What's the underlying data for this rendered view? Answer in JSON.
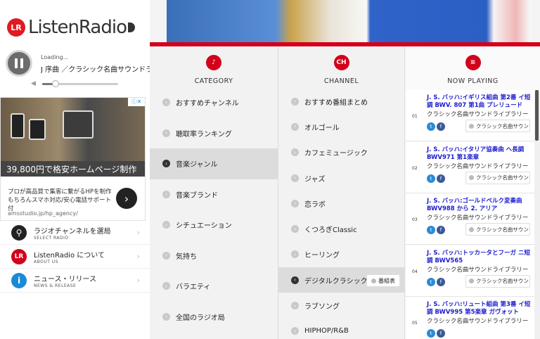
{
  "brand": {
    "logo_mark": "LR",
    "logo_text": "ListenRadio",
    "colors": {
      "accent": "#d3001b",
      "link": "#1b1bd0"
    }
  },
  "player": {
    "status": "Loading...",
    "track": "J 序曲 ／クラシック名曲サウンドラ",
    "volume_percent": 18,
    "icons": {
      "control": "pause-icon",
      "volume": "speaker-icon"
    }
  },
  "ad": {
    "badge": "ⓘ✕",
    "price": "39,800円で格安ホームページ制作",
    "desc_line1": "プロが高品質で集客に繋がるHPを制作",
    "desc_line2": "もちろんスマホ対応/安心電話サポート付",
    "arrow": "›",
    "url": "amsstudio.jp/hp_agency/"
  },
  "menu": [
    {
      "label": "ラジオチャンネルを選局",
      "sub": "SELECT RADIO",
      "icon": "search-icon",
      "glyph": "⚲",
      "color": "#222"
    },
    {
      "label": "ListenRadio について",
      "sub": "ABOUT US",
      "icon": "listenradio-icon",
      "glyph": "LR",
      "color": "#d3001b"
    },
    {
      "label": "ニュース・リリース",
      "sub": "NEWS & RELEASE",
      "icon": "info-icon",
      "glyph": "i",
      "color": "#1a8ad6"
    }
  ],
  "columns": {
    "category": {
      "title": "CATEGORY",
      "icon": "music-note-icon",
      "glyph": "♪"
    },
    "channel": {
      "title": "CHANNEL",
      "icon": "channel-icon",
      "glyph": "CH"
    },
    "now_playing": {
      "title": "NOW PLAYING",
      "icon": "list-icon",
      "glyph": "≡"
    }
  },
  "categories": [
    "おすすめチャンネル",
    "聴取率ランキング",
    "音楽ジャンル",
    "音楽ブランド",
    "シチュエーション",
    "気持ち",
    "バラエティ",
    "全国のラジオ局"
  ],
  "active_category": 2,
  "channels": [
    "おすすめ番組まとめ",
    "オルゴール",
    "カフェミュージック",
    "ジャズ",
    "恋ラボ",
    "くつろぎClassic",
    "ヒーリング",
    "デジタルクラシック",
    "ラブソング",
    "HIPHOP/R&B"
  ],
  "active_channel": 7,
  "schedule_label": "番組表",
  "now_playing": [
    {
      "num": "01",
      "title": "J. S. バッハ:イギリス組曲 第2番 イ短調 BWV. 807 第1曲 プレリュード",
      "artist": "クラシック名曲サウンドライブラリー",
      "tag": "クラシック名曲サウンドラ"
    },
    {
      "num": "02",
      "title": "J. S. バッハ:イタリア協奏曲 ヘ長調 BWV971 第1楽章",
      "artist": "クラシック名曲サウンドライブラリー",
      "tag": "クラシック名曲サウンドラ"
    },
    {
      "num": "03",
      "title": "J. S. バッハ:ゴールドベルク変奏曲 BWV988 から 2. アリア",
      "artist": "クラシック名曲サウンドライブラリー",
      "tag": "クラシック名曲サウンドラ"
    },
    {
      "num": "04",
      "title": "J. S. バッハ:トッカータとフーガ ニ短調 BWV565",
      "artist": "クラシック名曲サウンドライブラリー",
      "tag": "クラシック名曲サウンドラ"
    },
    {
      "num": "05",
      "title": "J. S. バッハ:リュート組曲 第3番 イ短調 BWV995 第5楽章 ガヴォット",
      "artist": "クラシック名曲サウンドライブラリー",
      "tag": ""
    }
  ]
}
